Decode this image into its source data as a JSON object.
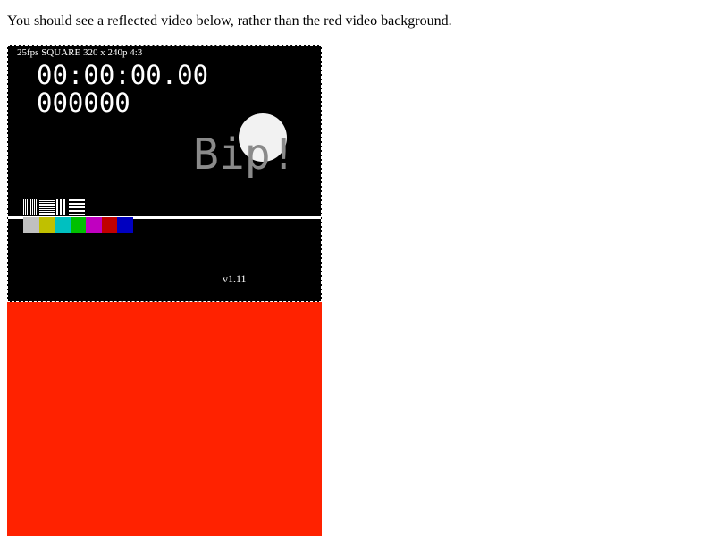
{
  "instruction": "You should see a reflected video below, rather than the red video background.",
  "video": {
    "background_color": "#ff2200",
    "fps_label": "25fps SQUARE 320 x 240p 4:3",
    "timecode": "00:00:00.00",
    "frame_counter": "000000",
    "bip": "Bip!",
    "version": "v1.11",
    "color_bars": [
      "#c0c0c0",
      "#c0c000",
      "#00c0c0",
      "#00c000",
      "#c000c0",
      "#c00000",
      "#0000c0"
    ],
    "test_patterns": [
      "vertical-stripes-fine",
      "horizontal-stripes-fine",
      "vertical-stripes-coarse",
      "horizontal-stripes-coarse"
    ]
  }
}
